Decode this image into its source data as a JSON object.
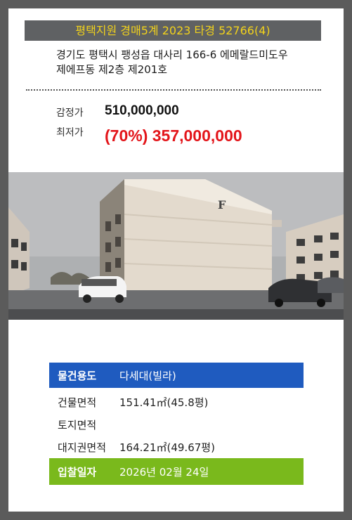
{
  "case": {
    "title": "평택지원 경매5계 2023 타경 52766(4)"
  },
  "address": {
    "line1": "경기도 평택시 팽성읍 대사리 166-6 에메랄드미도우",
    "line2": "제에프동 제2층 제201호"
  },
  "prices": {
    "appraisal_label": "감정가",
    "appraisal_value": "510,000,000",
    "minimum_label": "최저가",
    "minimum_value": "(70%) 357,000,000"
  },
  "photo": {
    "building_letter": "F"
  },
  "details": {
    "usage_label": "물건용도",
    "usage_value": "다세대(빌라)",
    "building_area_label": "건물면적",
    "building_area_value": "151.41㎡(45.8평)",
    "land_area_label": "토지면적",
    "land_area_value": "",
    "land_right_label": "대지권면적",
    "land_right_value": "164.21㎡(49.67평)",
    "bid_date_label": "입찰일자",
    "bid_date_value": "2026년 02월 24일"
  },
  "colors": {
    "title_bg": "#5f6163",
    "title_text": "#f2d21b",
    "min_price": "#e3151a",
    "usage_row": "#1f5bbf",
    "bid_row": "#7ab91c"
  }
}
